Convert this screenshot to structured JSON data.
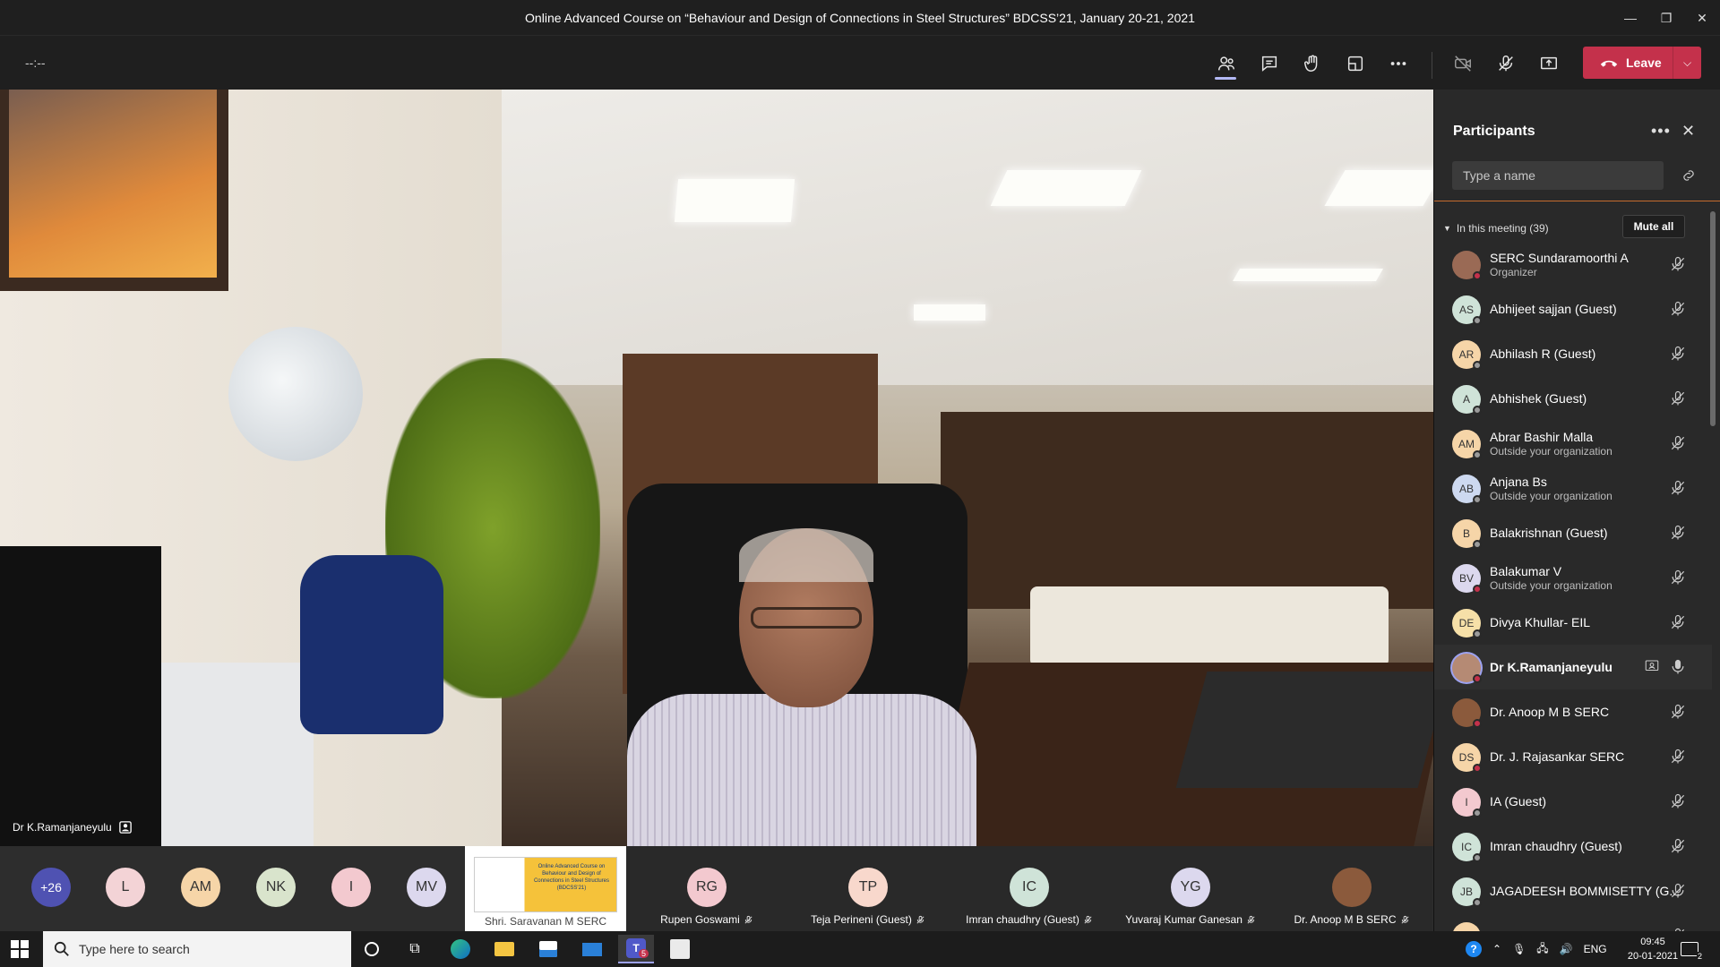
{
  "window": {
    "title": "Online Advanced Course on “Behaviour and Design of Connections in Steel Structures” BDCSS’21, January 20-21, 2021"
  },
  "toolbar": {
    "timer": "--:--",
    "leave_label": "Leave"
  },
  "video": {
    "speaker_name": "Dr K.Ramanjaneyulu"
  },
  "gallery": {
    "overflow_count": "+26",
    "avatars": [
      {
        "initials": "L",
        "color": "#f3d3d6"
      },
      {
        "initials": "AM",
        "color": "#f6d5a8"
      },
      {
        "initials": "NK",
        "color": "#d9e4cc"
      },
      {
        "initials": "I",
        "color": "#f3c9cf"
      },
      {
        "initials": "MV",
        "color": "#dcd8ee"
      }
    ],
    "shared_tile_name": "Shri. Saravanan M SERC",
    "shared_poster_text": "Online Advanced Course on Behaviour and Design of Connections in Steel Structures (BDCSS'21)",
    "tiles": [
      {
        "initials": "RG",
        "name": "Rupen Goswami",
        "color": "#f3c9cf"
      },
      {
        "initials": "TP",
        "name": "Teja Perineni (Guest)",
        "color": "#f8d8cc"
      },
      {
        "initials": "IC",
        "name": "Imran chaudhry (Guest)",
        "color": "#cfe3d8"
      },
      {
        "initials": "YG",
        "name": "Yuvaraj Kumar Ganesan",
        "color": "#dcd8ee"
      },
      {
        "initials": "",
        "name": "Dr. Anoop M B SERC",
        "color": "#8b5a3c"
      }
    ]
  },
  "participants": {
    "title": "Participants",
    "search_placeholder": "Type a name",
    "section_label": "In this meeting (39)",
    "mute_all_label": "Mute all",
    "items": [
      {
        "initials": "",
        "name": "SERC Sundaramoorthi A",
        "sub": "Organizer",
        "color": "#9a6a55",
        "status": "busy"
      },
      {
        "initials": "AS",
        "name": "Abhijeet sajjan (Guest)",
        "sub": "",
        "color": "#cfe3d8",
        "status": "away"
      },
      {
        "initials": "AR",
        "name": "Abhilash R (Guest)",
        "sub": "",
        "color": "#f6d5a8",
        "status": "away"
      },
      {
        "initials": "A",
        "name": "Abhishek (Guest)",
        "sub": "",
        "color": "#cfe3d8",
        "status": "away"
      },
      {
        "initials": "AM",
        "name": "Abrar Bashir Malla",
        "sub": "Outside your organization",
        "color": "#f6d5a8",
        "status": "away"
      },
      {
        "initials": "AB",
        "name": "Anjana Bs",
        "sub": "Outside your organization",
        "color": "#cdd9f0",
        "status": "away"
      },
      {
        "initials": "B",
        "name": "Balakrishnan (Guest)",
        "sub": "",
        "color": "#f6d5a8",
        "status": "away"
      },
      {
        "initials": "BV",
        "name": "Balakumar V",
        "sub": "Outside your organization",
        "color": "#dcd8ee",
        "status": "busy"
      },
      {
        "initials": "DE",
        "name": "Divya Khullar- EIL",
        "sub": "",
        "color": "#f6e0a8",
        "status": "away"
      },
      {
        "initials": "",
        "name": "Dr K.Ramanjaneyulu",
        "sub": "",
        "color": "#b58a74",
        "status": "busy"
      },
      {
        "initials": "",
        "name": "Dr. Anoop M B SERC",
        "sub": "",
        "color": "#8b5a3c",
        "status": "busy"
      },
      {
        "initials": "DS",
        "name": "Dr. J. Rajasankar SERC",
        "sub": "",
        "color": "#f6d5a8",
        "status": "busy"
      },
      {
        "initials": "I",
        "name": "IA (Guest)",
        "sub": "",
        "color": "#f3c9cf",
        "status": "away"
      },
      {
        "initials": "IC",
        "name": "Imran chaudhry (Guest)",
        "sub": "",
        "color": "#cfe3d8",
        "status": "away"
      },
      {
        "initials": "JB",
        "name": "JAGADEESH BOMMISETTY (G...",
        "sub": "",
        "color": "#cfe3d8",
        "status": "away"
      },
      {
        "initials": "",
        "name": "LOKESWARI",
        "sub": "",
        "color": "#f6d5a8",
        "status": "away"
      }
    ]
  },
  "taskbar": {
    "search_placeholder": "Type here to search",
    "teams_badge": "5",
    "language": "ENG",
    "time": "09:45",
    "date": "20-01-2021",
    "notification_count": "2"
  }
}
